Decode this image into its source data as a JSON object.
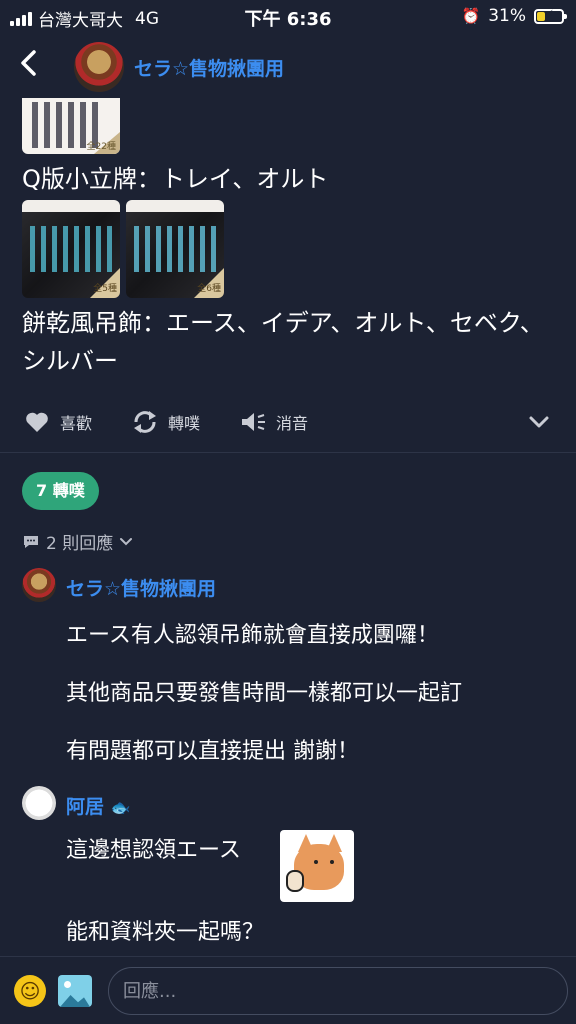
{
  "status_bar": {
    "carrier": "台灣大哥大",
    "network": "4G",
    "time": "下午 6:36",
    "battery": "31%",
    "battery_level": 0.31
  },
  "header": {
    "title": "セラ☆售物揪團用"
  },
  "post": {
    "caption_1": "Q版小立牌：トレイ、オルト",
    "caption_2": "餅乾風吊飾：エース、イデア、オルト、セベク、シルバー",
    "image_tags": [
      "全22種",
      "全5種",
      "全6種"
    ]
  },
  "actions": {
    "like": "喜歡",
    "repost": "轉噗",
    "mute": "消音"
  },
  "repost_pill": "7 轉噗",
  "replies_toggle": "2 則回應",
  "comments": [
    {
      "author": "セラ☆售物揪團用",
      "lines": [
        "エース有人認領吊飾就會直接成團囉！",
        "其他商品只要發售時間一樣都可以一起訂",
        "有問題都可以直接提出 謝謝！"
      ]
    },
    {
      "author": "阿居",
      "lines": [
        "這邊想認領エース",
        "能和資料夾一起嗎？"
      ]
    }
  ],
  "reply_box": {
    "placeholder": "回應..."
  },
  "icons": {
    "back": "chevron-left-icon",
    "like": "heart-icon",
    "repost": "repost-icon",
    "mute": "speaker-mute-icon",
    "expand": "chevron-down-icon",
    "replies": "speech-bubble-icon",
    "emoji": "smiley-icon",
    "image": "image-icon",
    "fish": "fish-icon"
  },
  "colors": {
    "background": "#1c2233",
    "accent_blue": "#3c8df0",
    "repost_green": "#2fa57a"
  }
}
